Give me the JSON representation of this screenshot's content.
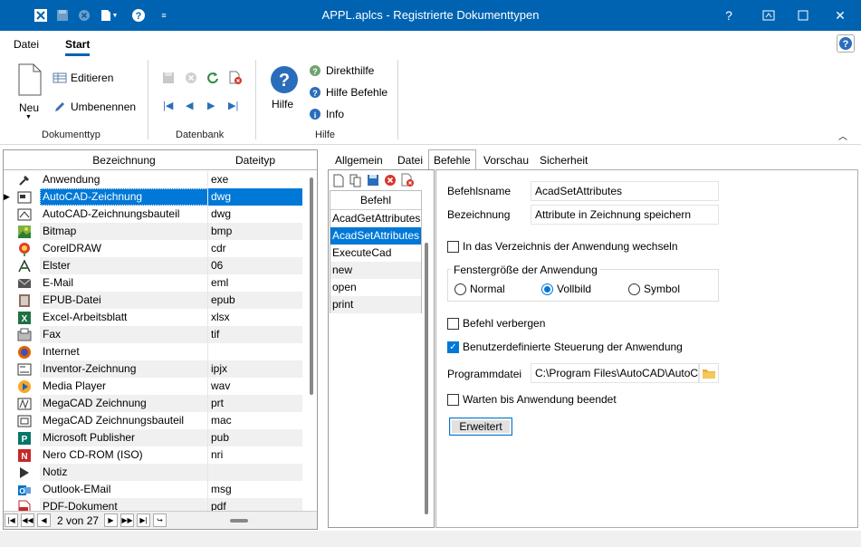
{
  "window": {
    "title": "APPL.aplcs - Registrierte Dokumenttypen",
    "accent": "#0063b1"
  },
  "ribbon": {
    "tabs": [
      "Datei",
      "Start"
    ],
    "active_tab": "Start",
    "groups": {
      "dokumenttyp": {
        "label": "Dokumenttyp",
        "neu": "Neu",
        "editieren": "Editieren",
        "umbenennen": "Umbenennen"
      },
      "datenbank": {
        "label": "Datenbank"
      },
      "hilfe": {
        "label": "Hilfe",
        "hilfe": "Hilfe",
        "direkthilfe": "Direkthilfe",
        "hilfe_befehle": "Hilfe Befehle",
        "info": "Info"
      }
    }
  },
  "grid": {
    "columns": [
      "Bezeichnung",
      "Dateityp"
    ],
    "rows": [
      {
        "name": "Anwendung",
        "ext": "exe",
        "icon": "application-icon"
      },
      {
        "name": "AutoCAD-Zeichnung",
        "ext": "dwg",
        "icon": "autocad-icon",
        "selected": true
      },
      {
        "name": "AutoCAD-Zeichnungsbauteil",
        "ext": "dwg",
        "icon": "autocad-part-icon"
      },
      {
        "name": "Bitmap",
        "ext": "bmp",
        "icon": "bitmap-icon"
      },
      {
        "name": "CorelDRAW",
        "ext": "cdr",
        "icon": "coreldraw-icon"
      },
      {
        "name": "Elster",
        "ext": "06",
        "icon": "elster-icon"
      },
      {
        "name": "E-Mail",
        "ext": "eml",
        "icon": "email-icon"
      },
      {
        "name": "EPUB-Datei",
        "ext": "epub",
        "icon": "epub-icon"
      },
      {
        "name": "Excel-Arbeitsblatt",
        "ext": "xlsx",
        "icon": "excel-icon"
      },
      {
        "name": "Fax",
        "ext": "tif",
        "icon": "fax-icon"
      },
      {
        "name": "Internet",
        "ext": "",
        "icon": "firefox-icon"
      },
      {
        "name": "Inventor-Zeichnung",
        "ext": "ipjx",
        "icon": "inventor-icon"
      },
      {
        "name": "Media Player",
        "ext": "wav",
        "icon": "media-player-icon"
      },
      {
        "name": "MegaCAD Zeichnung",
        "ext": "prt",
        "icon": "megacad-icon"
      },
      {
        "name": "MegaCAD Zeichnungsbauteil",
        "ext": "mac",
        "icon": "megacad-part-icon"
      },
      {
        "name": "Microsoft Publisher",
        "ext": "pub",
        "icon": "publisher-icon"
      },
      {
        "name": "Nero CD-ROM (ISO)",
        "ext": "nri",
        "icon": "nero-icon"
      },
      {
        "name": "Notiz",
        "ext": "",
        "icon": "note-icon"
      },
      {
        "name": "Outlook-EMail",
        "ext": "msg",
        "icon": "outlook-icon"
      },
      {
        "name": "PDF-Dokument",
        "ext": "pdf",
        "icon": "pdf-icon"
      }
    ],
    "pager": "2 von 27"
  },
  "tabs": [
    "Allgemein",
    "Datei",
    "Befehle",
    "Vorschau",
    "Sicherheit"
  ],
  "active_tab": "Befehle",
  "commands": {
    "header": "Befehl",
    "items": [
      "AcadGetAttributes",
      "AcadSetAttributes",
      "ExecuteCad",
      "new",
      "open",
      "print"
    ],
    "selected": "AcadSetAttributes"
  },
  "detail": {
    "befehlsname_label": "Befehlsname",
    "befehlsname_value": "AcadSetAttributes",
    "bezeichnung_label": "Bezeichnung",
    "bezeichnung_value": "Attribute in Zeichnung speichern",
    "chk_verzeichnis": "In das Verzeichnis der Anwendung wechseln",
    "chk_verzeichnis_checked": false,
    "fenster_title": "Fenstergröße der Anwendung",
    "radio_normal": "Normal",
    "radio_vollbild": "Vollbild",
    "radio_symbol": "Symbol",
    "radio_selected": "Vollbild",
    "chk_verbergen": "Befehl verbergen",
    "chk_verbergen_checked": false,
    "chk_steuerung": "Benutzerdefinierte Steuerung der Anwendung",
    "chk_steuerung_checked": true,
    "programmdatei_label": "Programmdatei",
    "programmdatei_value": "C:\\Program Files\\AutoCAD\\AutoC",
    "chk_warten": "Warten bis Anwendung beendet",
    "chk_warten_checked": false,
    "erweitert": "Erweitert"
  }
}
